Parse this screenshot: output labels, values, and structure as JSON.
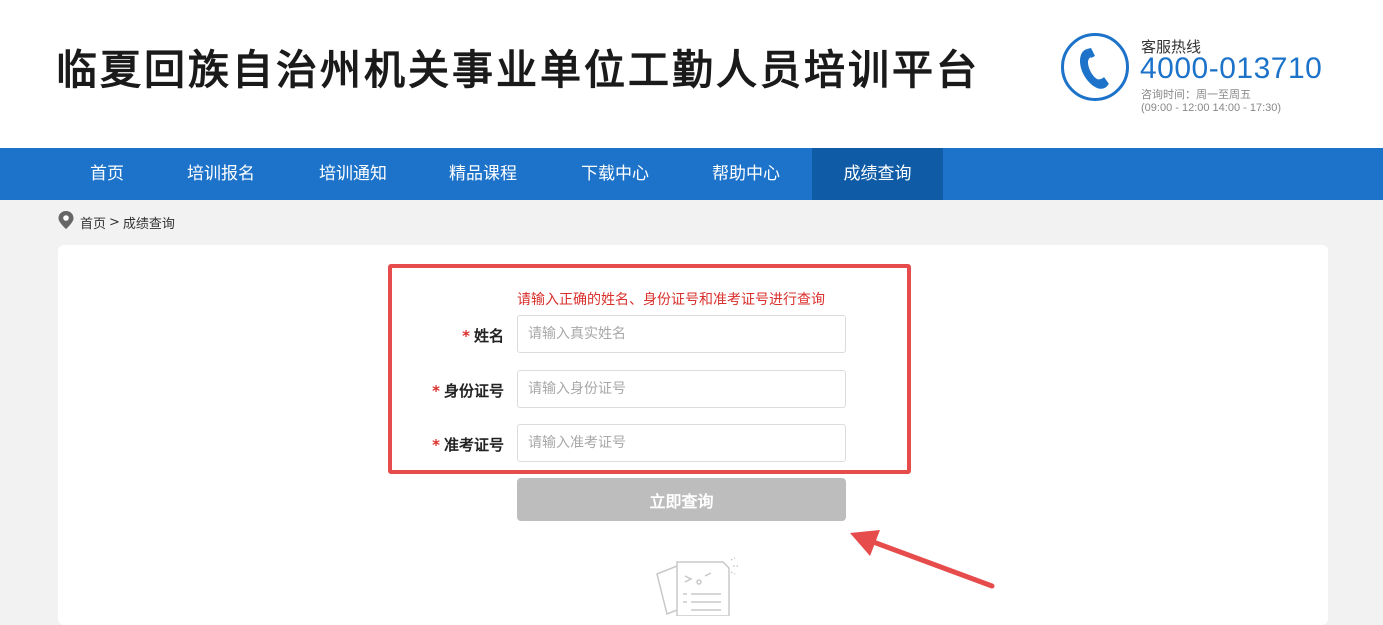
{
  "header": {
    "site_title": "临夏回族自治州机关事业单位工勤人员培训平台",
    "hotline_label": "客服热线",
    "hotline_number": "4000-013710",
    "hours_line1": "咨询时间：周一至周五",
    "hours_line2": "(09:00 - 12:00 14:00 - 17:30)",
    "phone_icon": "phone-icon",
    "accent_color": "#1c73c9"
  },
  "nav": {
    "items": [
      {
        "label": "首页",
        "active": false
      },
      {
        "label": "培训报名",
        "active": false
      },
      {
        "label": "培训通知",
        "active": false
      },
      {
        "label": "精品课程",
        "active": false
      },
      {
        "label": "下载中心",
        "active": false
      },
      {
        "label": "帮助中心",
        "active": false
      },
      {
        "label": "成绩查询",
        "active": true
      }
    ],
    "bg_color": "#1c73c9",
    "active_color": "#0f5ba6"
  },
  "breadcrumb": {
    "icon": "location-pin-icon",
    "home": "首页",
    "separator": ">",
    "current": "成绩查询"
  },
  "form": {
    "hint": "请输入正确的姓名、身份证号和准考证号进行查询",
    "required_mark": "*",
    "fields": [
      {
        "label": "姓名",
        "placeholder": "请输入真实姓名",
        "value": ""
      },
      {
        "label": "身份证号",
        "placeholder": "请输入身份证号",
        "value": ""
      },
      {
        "label": "准考证号",
        "placeholder": "请输入准考证号",
        "value": ""
      }
    ],
    "submit_label": "立即查询",
    "highlight_color": "#e74c4c"
  },
  "empty_state": {
    "icon": "empty-document-icon"
  }
}
